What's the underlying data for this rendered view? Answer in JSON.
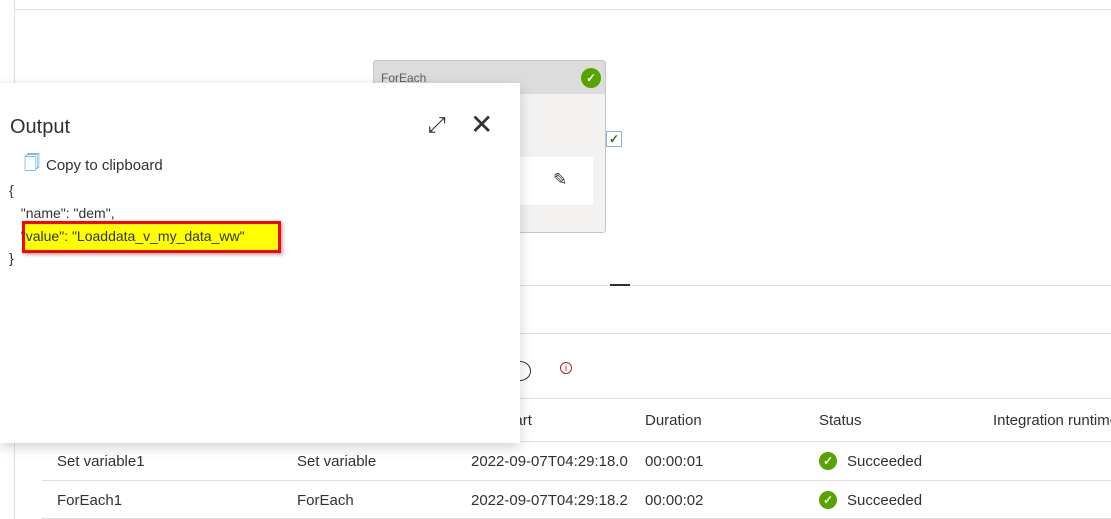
{
  "canvas": {
    "card": {
      "title": "ForEach",
      "status_icon": "check-circle-icon"
    }
  },
  "output_panel": {
    "title": "Output",
    "copy_label": "Copy to clipboard",
    "json_lines": [
      "{",
      "  \"name\": \"dem\",",
      "  \"value\": \"Loaddata_v_my_data_ww\"",
      "}"
    ],
    "highlight_color": "#ffff00",
    "highlight_border": "#ff0000"
  },
  "table": {
    "headers": [
      "Run start",
      "Duration",
      "Status",
      "Integration runtime"
    ],
    "rows": [
      {
        "name": "Set variable1",
        "type": "Set variable",
        "start": "2022-09-07T04:29:18.0",
        "duration": "00:00:01",
        "status": "Succeeded"
      },
      {
        "name": "ForEach1",
        "type": "ForEach",
        "start": "2022-09-07T04:29:18.2",
        "duration": "00:00:02",
        "status": "Succeeded"
      }
    ]
  },
  "colors": {
    "success": "#57a300",
    "accent": "#0078d4"
  }
}
